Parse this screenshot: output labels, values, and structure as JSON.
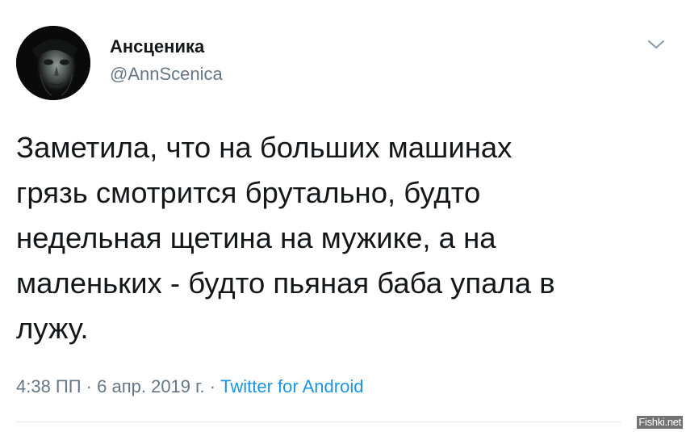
{
  "tweet": {
    "display_name": "Ансценика",
    "handle": "@AnnScenica",
    "text_lines": [
      "Заметила, что на больших машинах",
      "грязь смотрится брутально, будто",
      "недельная щетина на мужике, а на",
      "маленьких - будто пьяная баба упала в",
      "лужу."
    ],
    "time": "4:38 ПП",
    "separator": " · ",
    "date": "6 апр. 2019 г.",
    "source": "Twitter for Android"
  },
  "watermark": "Fishki.net",
  "icons": {
    "menu": "chevron-down-icon",
    "avatar": "avatar"
  },
  "colors": {
    "text": "#14171a",
    "secondary": "#657786",
    "link": "#1b95e0",
    "divider": "#e1e8ed"
  }
}
